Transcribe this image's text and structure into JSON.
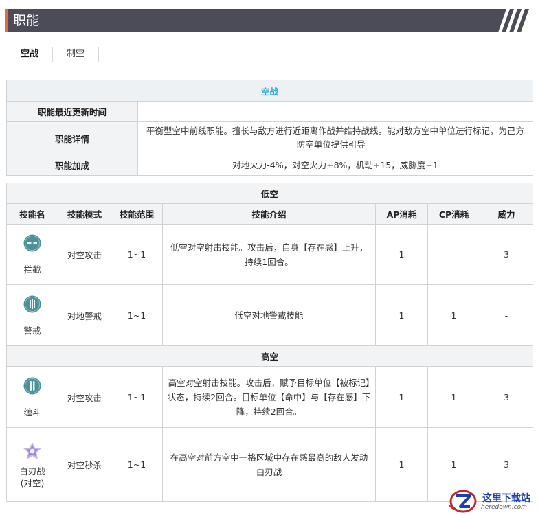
{
  "header": {
    "title": "职能"
  },
  "tabs": [
    {
      "label": "空战",
      "active": true
    },
    {
      "label": "制空",
      "active": false
    }
  ],
  "overview": {
    "caption": "空战",
    "rows": [
      {
        "label": "职能最近更新时间",
        "value": ""
      },
      {
        "label": "职能详情",
        "value": "平衡型空中前线职能。擅长与敌方进行近距离作战并维持战线。能对敌方空中单位进行标记，为己方防空单位提供引导。"
      },
      {
        "label": "职能加成",
        "value": "对地火力-4%，对空火力+8%，机动+15，威胁度+1"
      }
    ]
  },
  "skills": {
    "headers": [
      "技能名",
      "技能模式",
      "技能范围",
      "技能介绍",
      "AP消耗",
      "CP消耗",
      "威力"
    ],
    "sections": [
      {
        "title": "低空",
        "rows": [
          {
            "name": "拦截",
            "icon": "intercept-icon",
            "mode": "对空攻击",
            "range": "1~1",
            "desc": "低空对空射击技能。攻击后，自身【存在感】上升，持续1回合。",
            "ap": "1",
            "cp": "-",
            "power": "3"
          },
          {
            "name": "警戒",
            "icon": "alert-icon",
            "mode": "对地警戒",
            "range": "1~1",
            "desc": "低空对地警戒技能",
            "ap": "1",
            "cp": "1",
            "power": "-"
          }
        ]
      },
      {
        "title": "高空",
        "rows": [
          {
            "name": "缠斗",
            "icon": "dogfight-icon",
            "mode": "对空攻击",
            "range": "1~1",
            "desc": "高空对空射击技能。攻击后，赋予目标单位【被标记】状态，持续2回合。目标单位【命中】与【存在感】下降，持续2回合。",
            "ap": "1",
            "cp": "1",
            "power": "3"
          },
          {
            "name": "白刃战\n(对空)",
            "icon": "melee-burst-icon",
            "mode": "对空秒杀",
            "range": "1~1",
            "desc": "在高空对前方空中一格区域中存在感最高的敌人发动白刃战",
            "ap": "1",
            "cp": "1",
            "power": "3"
          }
        ]
      }
    ]
  },
  "watermark": {
    "line1": "这里下载站",
    "line2": "heredown.com"
  },
  "colors": {
    "header_bg": "#4b4c58",
    "header_accent": "#e8664a",
    "caption": "#2aa6d6",
    "label_bg": "#f2f3f5",
    "border": "#d2d2d2"
  }
}
